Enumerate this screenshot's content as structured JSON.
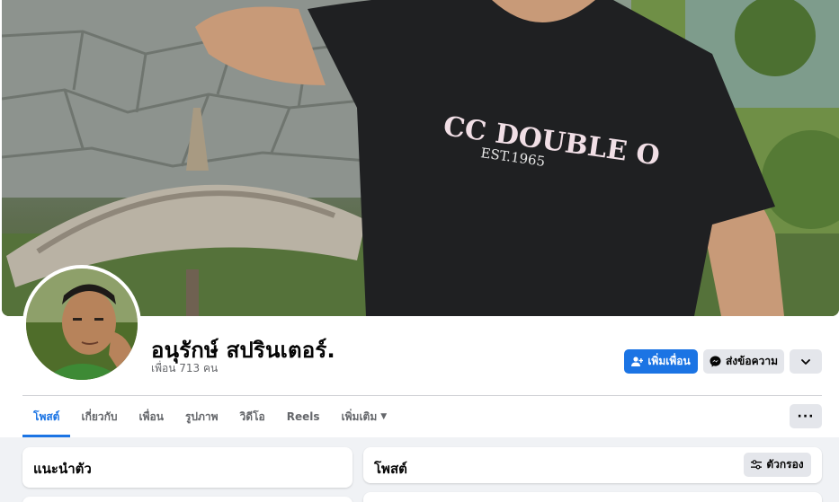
{
  "profile": {
    "name": "อนุรักษ์ สปรินเตอร์.",
    "friends_count": "เพื่อน 713 คน",
    "cover_shirt_text_line1": "CC DOUBLE O",
    "cover_shirt_text_line2": "EST.1965"
  },
  "actions": {
    "add_friend": "เพิ่มเพื่อน",
    "message": "ส่งข้อความ",
    "more_icon": "chevron-down-icon"
  },
  "tabs": [
    {
      "label": "โพสต์",
      "active": true
    },
    {
      "label": "เกี่ยวกับ",
      "active": false
    },
    {
      "label": "เพื่อน",
      "active": false
    },
    {
      "label": "รูปภาพ",
      "active": false
    },
    {
      "label": "วิดีโอ",
      "active": false
    },
    {
      "label": "Reels",
      "active": false
    },
    {
      "label": "เพิ่มเติม",
      "active": false
    }
  ],
  "tabs_more_button": "···",
  "intro_card": {
    "title": "แนะนำตัว"
  },
  "posts_card": {
    "title": "โพสต์",
    "filter_label": "ตัวกรอง"
  },
  "colors": {
    "accent": "#1b74e4",
    "secondary_button": "#e4e6eb",
    "muted_text": "#65676b"
  }
}
